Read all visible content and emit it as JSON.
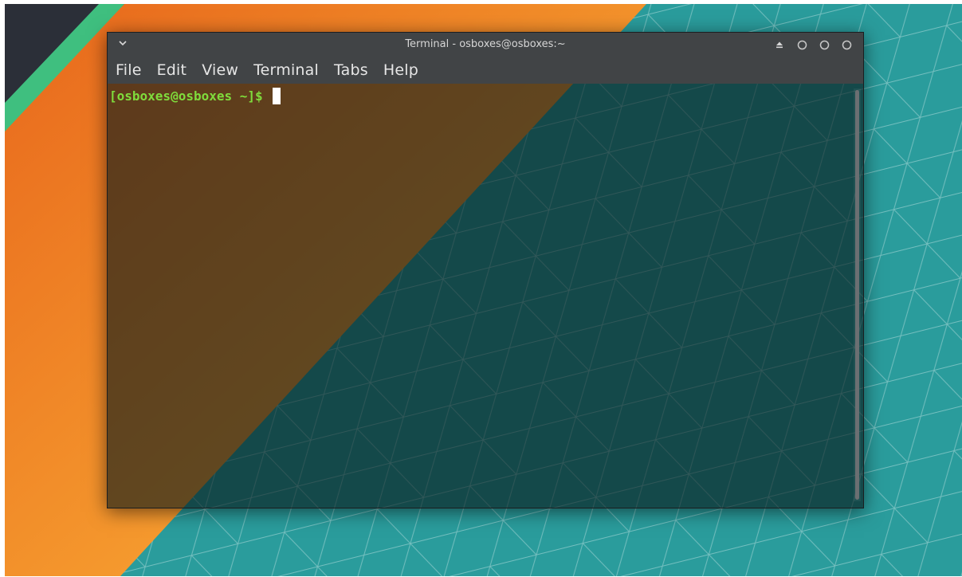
{
  "desktop": {
    "colors": {
      "teal": "#2a9c9c",
      "orange": "#f08a24",
      "green_stripe": "#3fbf7f",
      "dark_corner": "#2b2f38"
    }
  },
  "window": {
    "title": "Terminal - osboxes@osboxes:~",
    "titlebar_icons": [
      "chevron-down-icon",
      "keep-above-icon",
      "minimize-icon",
      "maximize-icon",
      "close-icon"
    ],
    "menu": [
      "File",
      "Edit",
      "View",
      "Terminal",
      "Tabs",
      "Help"
    ],
    "prompt": "[osboxes@osboxes ~]$",
    "colors": {
      "titlebar": "#414446",
      "prompt_text": "#7fdc3c",
      "cursor": "#ffffff"
    }
  }
}
